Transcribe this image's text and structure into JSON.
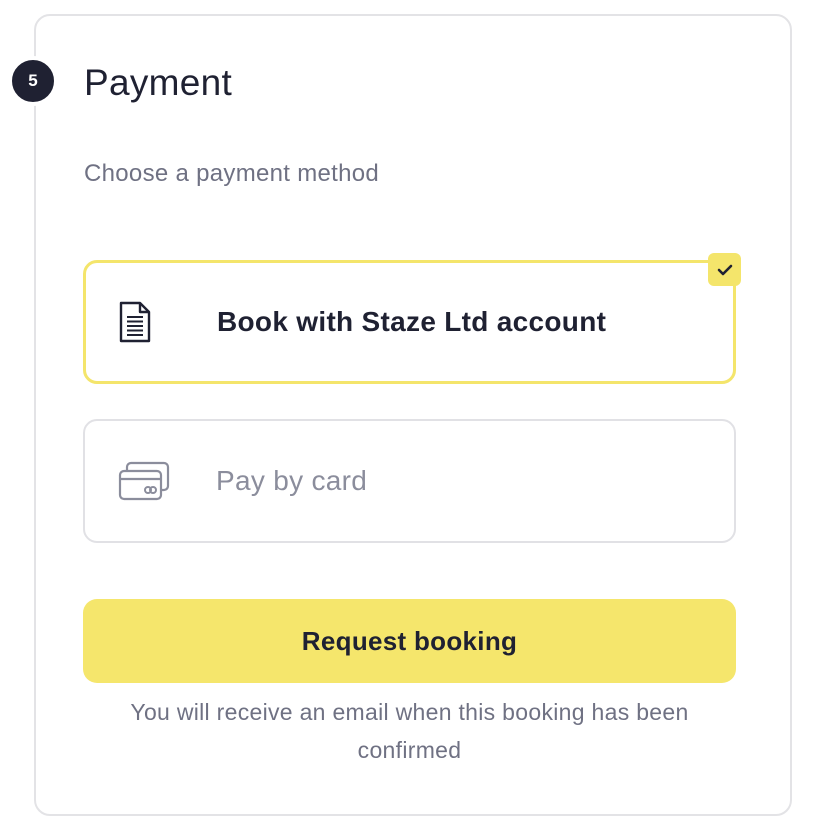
{
  "step": {
    "number": "5",
    "title": "Payment"
  },
  "subtitle": "Choose a payment method",
  "payment_options": [
    {
      "label": "Book with Staze Ltd account",
      "icon": "document-icon",
      "selected": true
    },
    {
      "label": "Pay by card",
      "icon": "credit-card-icon",
      "selected": false
    }
  ],
  "cta": {
    "label": "Request booking"
  },
  "note": "You will receive an email when this booking has been confirmed",
  "colors": {
    "accent": "#f5e66c",
    "badge": "#1f2132",
    "text_dark": "#1f2132",
    "text_muted": "#6f7183"
  }
}
